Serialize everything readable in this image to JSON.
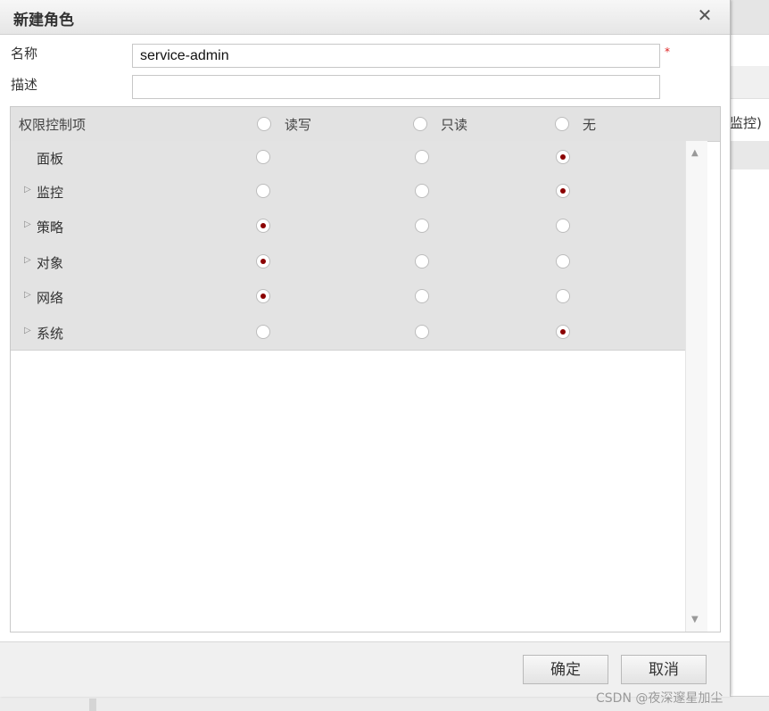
{
  "dialog": {
    "title": "新建角色",
    "close_glyph": "✕"
  },
  "form": {
    "name_label": "名称",
    "name_value": "service-admin",
    "required_mark": "*",
    "desc_label": "描述",
    "desc_value": ""
  },
  "permissions": {
    "header_label": "权限控制项",
    "columns": [
      "读写",
      "只读",
      "无"
    ],
    "rows": [
      {
        "label": "面板",
        "expandable": false,
        "selected": 2
      },
      {
        "label": "监控",
        "expandable": true,
        "selected": 2
      },
      {
        "label": "策略",
        "expandable": true,
        "selected": 0
      },
      {
        "label": "对象",
        "expandable": true,
        "selected": 0
      },
      {
        "label": "网络",
        "expandable": true,
        "selected": 0
      },
      {
        "label": "系统",
        "expandable": true,
        "selected": 2
      }
    ],
    "expand_glyph": "▷",
    "scroll_up_glyph": "▲",
    "scroll_down_glyph": "▼"
  },
  "footer": {
    "confirm_label": "确定",
    "cancel_label": "取消"
  },
  "background": {
    "partial_text": "监控)"
  },
  "watermark": "CSDN @夜深邃星加尘",
  "colors": {
    "selected_dot": "#8b0000",
    "required": "#dd2222"
  }
}
